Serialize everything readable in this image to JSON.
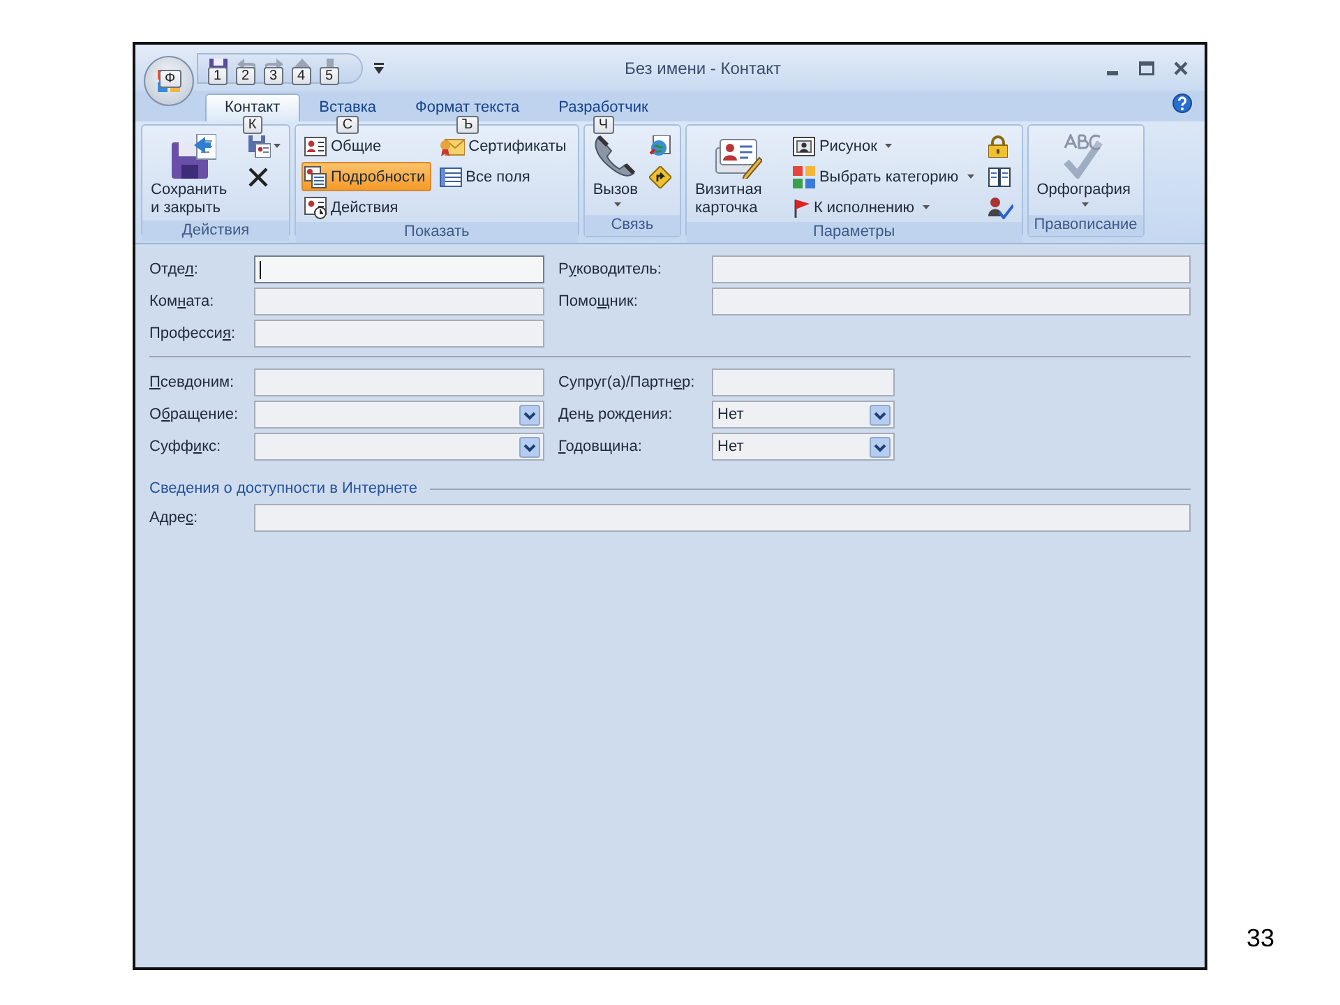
{
  "window": {
    "title": "Без имени - Контакт"
  },
  "office_button": {
    "keytip": "Ф"
  },
  "quick_access": [
    {
      "keytip": "1"
    },
    {
      "keytip": "2"
    },
    {
      "keytip": "3"
    },
    {
      "keytip": "4"
    },
    {
      "keytip": "5"
    }
  ],
  "tabs": [
    {
      "label": "Контакт",
      "keytip": "К",
      "selected": true
    },
    {
      "label": "Вставка",
      "keytip": "С",
      "selected": false
    },
    {
      "label": "Формат текста",
      "keytip": "Ъ",
      "selected": false
    },
    {
      "label": "Разработчик",
      "keytip": "Ч",
      "selected": false
    }
  ],
  "ribbon_groups": [
    {
      "label": "Действия",
      "buttons": [
        {
          "kind": "large",
          "label": "Сохранить и закрыть",
          "dropdown": false
        },
        {
          "kind": "icon",
          "dropdown": true
        },
        {
          "kind": "icon",
          "dropdown": false
        }
      ]
    },
    {
      "label": "Показать",
      "buttons": [
        {
          "kind": "small",
          "label": "Общие",
          "dropdown": false,
          "selected": false
        },
        {
          "kind": "small",
          "label": "Подробности",
          "dropdown": false,
          "selected": true
        },
        {
          "kind": "small",
          "label": "Действия",
          "dropdown": false,
          "selected": false
        },
        {
          "kind": "small",
          "label": "Сертификаты",
          "dropdown": false,
          "selected": false
        },
        {
          "kind": "small",
          "label": "Все поля",
          "dropdown": false,
          "selected": false
        }
      ]
    },
    {
      "label": "Связь",
      "buttons": [
        {
          "kind": "large",
          "label": "Вызов",
          "dropdown": true
        },
        {
          "kind": "icon",
          "dropdown": false
        },
        {
          "kind": "icon",
          "dropdown": false
        }
      ]
    },
    {
      "label": "Параметры",
      "buttons": [
        {
          "kind": "large",
          "label": "Визитная карточка",
          "dropdown": false
        },
        {
          "kind": "small",
          "label": "Рисунок",
          "dropdown": true
        },
        {
          "kind": "small",
          "label": "Выбрать категорию",
          "dropdown": true
        },
        {
          "kind": "small",
          "label": "К исполнению",
          "dropdown": true
        },
        {
          "kind": "icon",
          "dropdown": false
        },
        {
          "kind": "icon",
          "dropdown": false
        },
        {
          "kind": "icon",
          "dropdown": false
        }
      ]
    },
    {
      "label": "Правописание",
      "buttons": [
        {
          "kind": "large",
          "label": "Орфография",
          "dropdown": true
        }
      ]
    }
  ],
  "form": {
    "sections": [
      {
        "kind": "details",
        "rows": [
          {
            "kind": "pair",
            "left": {
              "label": [
                {
                  "text": "Отде"
                },
                {
                  "text": "л",
                  "underline": true
                },
                {
                  "text": ":"
                }
              ],
              "kind": "text",
              "focused": true
            },
            "right": {
              "label": [
                {
                  "text": "Р"
                },
                {
                  "text": "у",
                  "underline": true
                },
                {
                  "text": "ководитель:"
                }
              ],
              "kind": "text",
              "focused": false
            }
          },
          {
            "kind": "pair",
            "left": {
              "label": [
                {
                  "text": "Ком"
                },
                {
                  "text": "н",
                  "underline": true
                },
                {
                  "text": "ата:"
                }
              ],
              "kind": "text",
              "focused": false
            },
            "right": {
              "label": [
                {
                  "text": "Помо"
                },
                {
                  "text": "щ",
                  "underline": true
                },
                {
                  "text": "ник:"
                }
              ],
              "kind": "text",
              "focused": false
            }
          },
          {
            "kind": "left_only",
            "left": {
              "label": [
                {
                  "text": "Професси"
                },
                {
                  "text": "я",
                  "underline": true
                },
                {
                  "text": ":"
                }
              ],
              "kind": "text",
              "focused": false
            }
          }
        ]
      },
      {
        "kind": "personal",
        "rows": [
          {
            "kind": "pair",
            "left": {
              "label": [
                {
                  "text": "П",
                  "underline": true
                },
                {
                  "text": "севдоним:"
                }
              ],
              "kind": "text",
              "focused": false
            },
            "right": {
              "label": [
                {
                  "text": "Супруг(а)/Партн"
                },
                {
                  "text": "е",
                  "underline": true
                },
                {
                  "text": "р:"
                }
              ],
              "kind": "text",
              "focused": false
            }
          },
          {
            "kind": "pair",
            "left": {
              "label": [
                {
                  "text": "О"
                },
                {
                  "text": "б",
                  "underline": true
                },
                {
                  "text": "ращение:"
                }
              ],
              "kind": "dropdown"
            },
            "right": {
              "label": [
                {
                  "text": "Ден"
                },
                {
                  "text": "ь",
                  "underline": true
                },
                {
                  "text": " рождения:"
                }
              ],
              "kind": "dropdown",
              "value": "Нет"
            }
          },
          {
            "kind": "pair",
            "left": {
              "label": [
                {
                  "text": "Суфф"
                },
                {
                  "text": "и",
                  "underline": true
                },
                {
                  "text": "кс:"
                }
              ],
              "kind": "dropdown"
            },
            "right": {
              "label": [
                {
                  "text": "Г",
                  "underline": true
                },
                {
                  "text": "одовщина:"
                }
              ],
              "kind": "dropdown",
              "value": "Нет"
            }
          }
        ]
      },
      {
        "kind": "internet",
        "heading": "Сведения о доступности в Интернете",
        "rows": [
          {
            "kind": "full",
            "left": {
              "label": [
                {
                  "text": "Адре"
                },
                {
                  "text": "с",
                  "underline": true
                },
                {
                  "text": ":"
                }
              ],
              "kind": "text",
              "focused": false
            }
          }
        ]
      }
    ]
  },
  "slide_number": "33"
}
